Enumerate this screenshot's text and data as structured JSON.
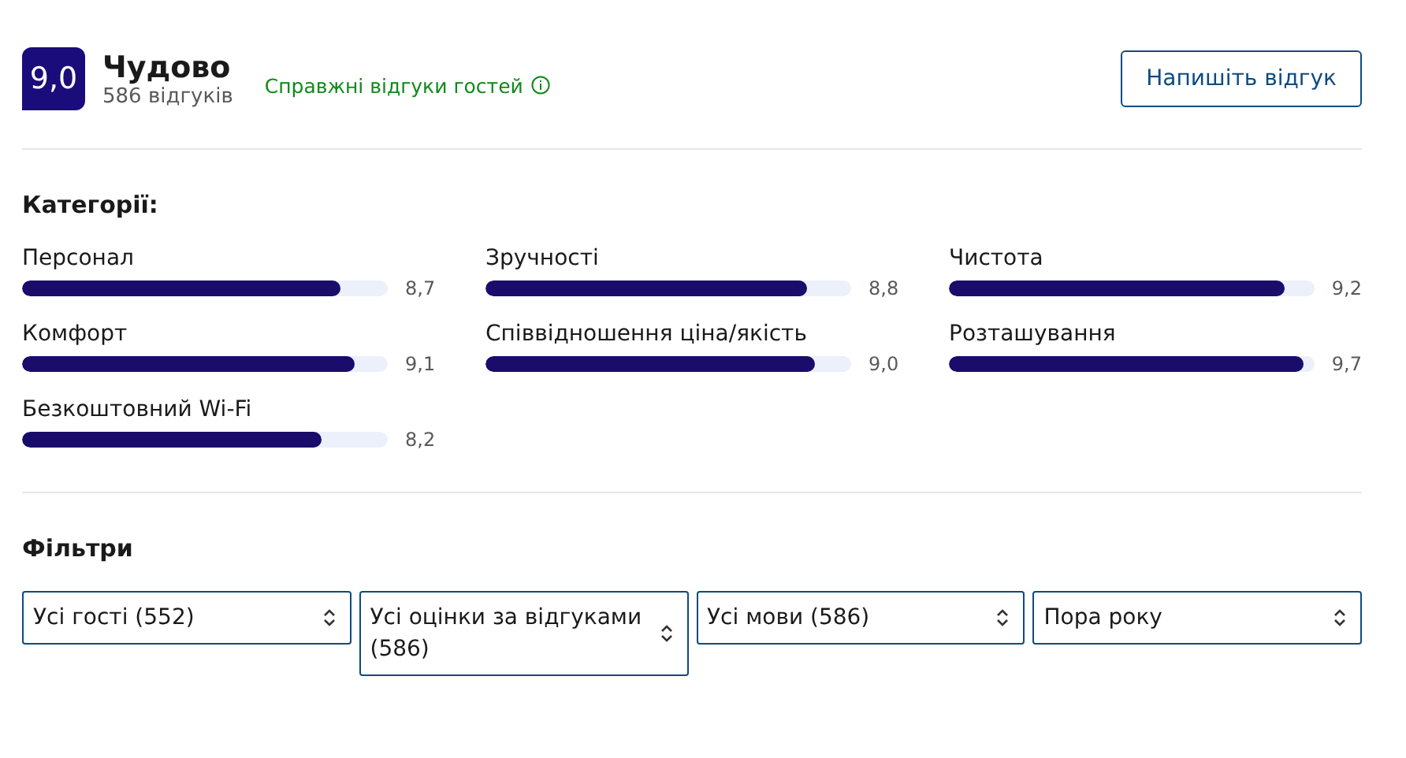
{
  "header": {
    "score": "9,0",
    "rating_word": "Чудово",
    "review_count": "586 відгуків",
    "verified_label": "Справжні відгуки гостей",
    "write_button": "Напишіть відгук"
  },
  "categories": {
    "title": "Категорії:",
    "items": [
      {
        "name": "Персонал",
        "reading": "8,7",
        "level": 0.87
      },
      {
        "name": "Зручності",
        "reading": "8,8",
        "level": 0.88
      },
      {
        "name": "Чистота",
        "reading": "9,2",
        "level": 0.92
      },
      {
        "name": "Комфорт",
        "reading": "9,1",
        "level": 0.91
      },
      {
        "name": "Співвідношення ціна/якість",
        "reading": "9,0",
        "level": 0.9
      },
      {
        "name": "Розташування",
        "reading": "9,7",
        "level": 0.97
      },
      {
        "name": "Безкоштовний Wi-Fi",
        "reading": "8,2",
        "level": 0.82
      }
    ]
  },
  "filters": {
    "title": "Фільтри",
    "selects": [
      {
        "value": "Усі гості (552)"
      },
      {
        "value": "Усі оцінки за відгуками (586)"
      },
      {
        "value": "Усі мови (586)"
      },
      {
        "value": "Пора року"
      }
    ]
  }
}
